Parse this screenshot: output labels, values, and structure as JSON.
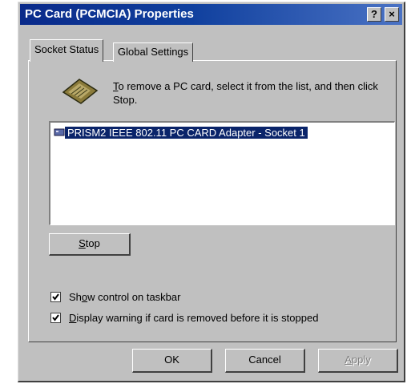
{
  "window": {
    "title": "PC Card (PCMCIA) Properties",
    "help_label": "?",
    "close_label": "×"
  },
  "tabs": [
    {
      "label": "Socket Status",
      "active": true
    },
    {
      "label": "Global Settings",
      "active": false
    }
  ],
  "instruction": {
    "text_mn": "T",
    "text_rest": "o remove a PC card, select it from the list, and then click Stop."
  },
  "icon": "pc-card-icon",
  "device_list": [
    {
      "label": "PRISM2 IEEE 802.11 PC CARD Adapter - Socket 1",
      "selected": true
    }
  ],
  "stop_button": {
    "mn": "S",
    "rest": "top"
  },
  "checkboxes": [
    {
      "pre": "Sh",
      "mn": "o",
      "rest": "w control on taskbar",
      "checked": true
    },
    {
      "pre": "",
      "mn": "D",
      "rest": "isplay warning if card is removed before it is stopped",
      "checked": true
    }
  ],
  "footer": {
    "ok_label": "OK",
    "cancel_label": "Cancel",
    "apply_mn": "A",
    "apply_rest": "pply",
    "apply_enabled": false
  },
  "colors": {
    "title_bar": "#0a2a8a",
    "selection": "#0a246a",
    "face": "#c0c0c0"
  }
}
